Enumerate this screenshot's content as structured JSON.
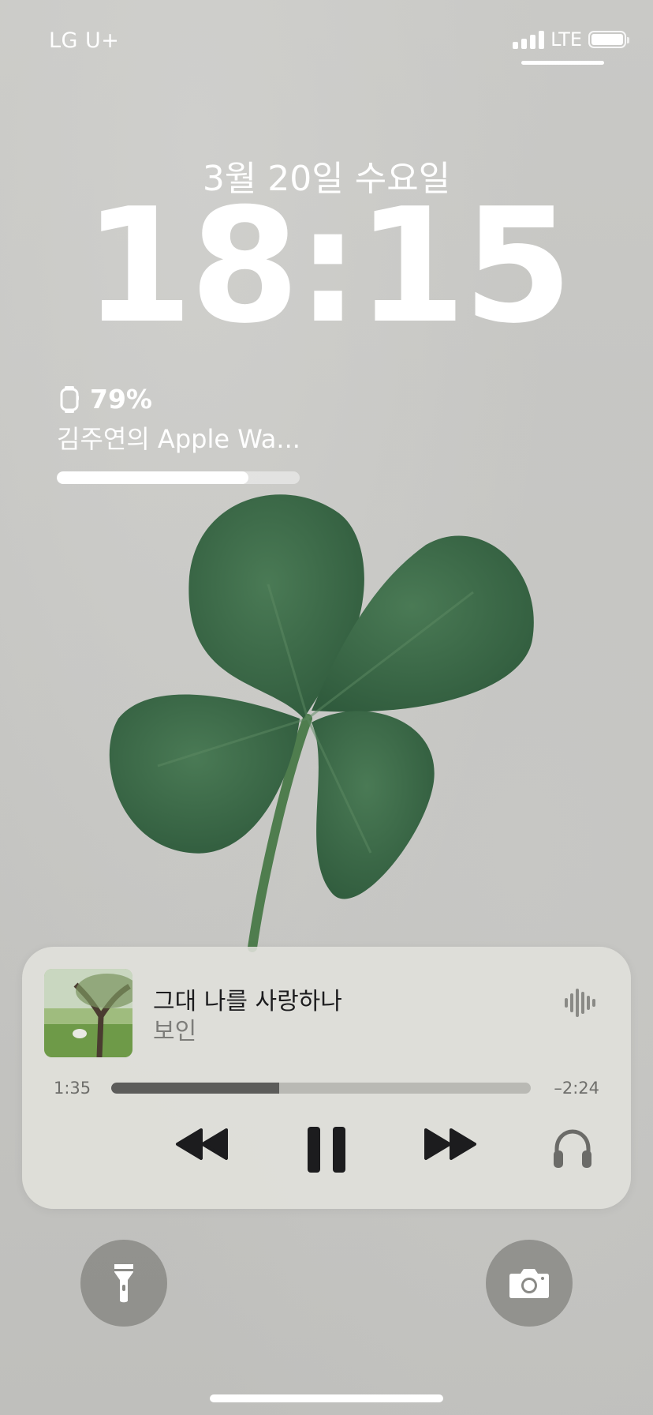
{
  "status_bar": {
    "carrier": "LG U+",
    "network": "LTE",
    "signal_bars": 4,
    "battery_level": 1.0
  },
  "lock_screen": {
    "date": "3월 20일 수요일",
    "time": "18:15"
  },
  "watch_widget": {
    "icon": "watch-icon",
    "percent_label": "79%",
    "device_name": "김주연의 Apple Wa...",
    "level": 0.79
  },
  "now_playing": {
    "title": "그대 나를 사랑하나",
    "artist": "보인",
    "elapsed": "1:35",
    "remaining": "–2:24",
    "progress": 0.4,
    "icons": {
      "output": "airplay-waveform-icon",
      "rewind": "rewind-icon",
      "pause": "pause-icon",
      "forward": "fast-forward-icon",
      "headphones": "headphones-icon"
    }
  },
  "quick_actions": {
    "left_icon": "flashlight-icon",
    "right_icon": "camera-icon"
  },
  "colors": {
    "wallpaper": "#c6c6c3",
    "clover_leaf": "#3f6b4a",
    "player_bg": "#e1e1dc",
    "player_text": "#1c1c1e",
    "player_secondary": "#7d7d7a"
  }
}
